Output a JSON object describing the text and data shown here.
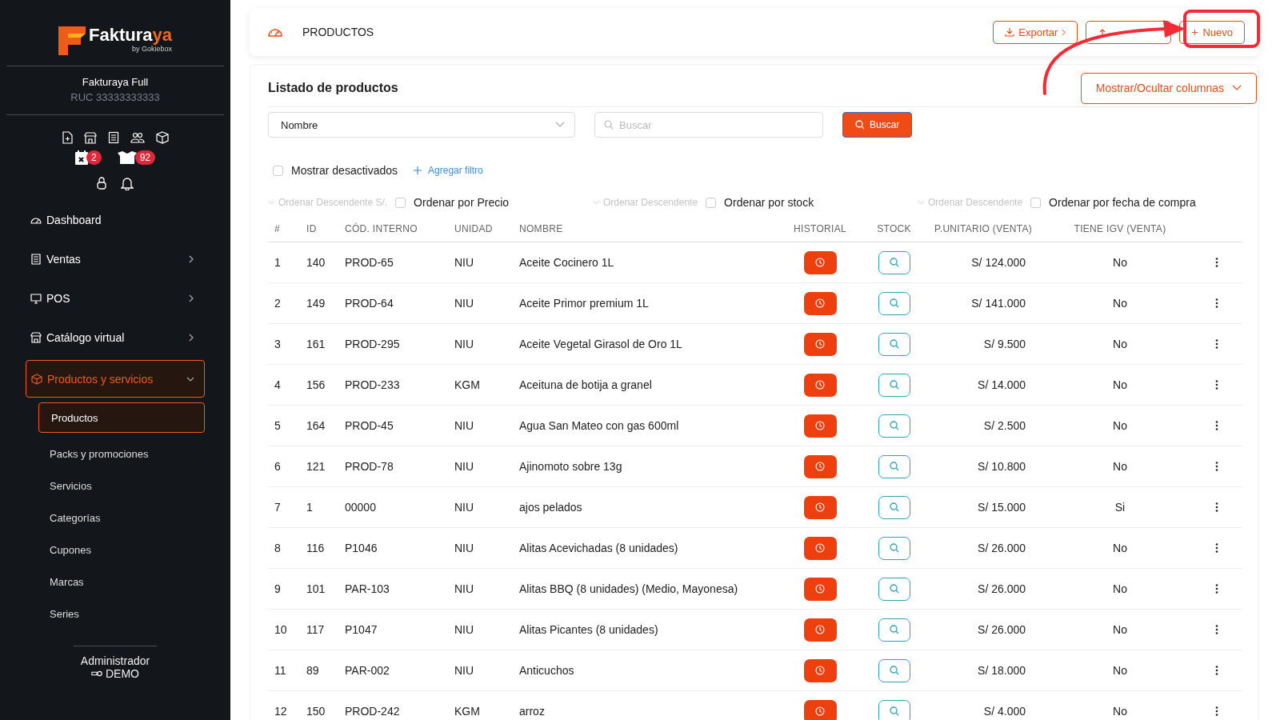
{
  "sidebar": {
    "brand": {
      "name": "Faktura",
      "accent": "ya",
      "tagline": "by Gokiebox"
    },
    "company": {
      "name": "Fakturaya Full",
      "ruc": "RUC 33333333333"
    },
    "badges": [
      {
        "kind": "calendar",
        "count": "2"
      },
      {
        "kind": "boxes",
        "count": "92"
      }
    ],
    "menu": [
      {
        "kind": "dashboard",
        "label": "Dashboard",
        "selected": false
      },
      {
        "kind": "sales",
        "label": "Ventas",
        "selected": false,
        "expanded": false
      },
      {
        "kind": "pos",
        "label": "POS",
        "selected": false,
        "expanded": false
      },
      {
        "kind": "store",
        "label": "Catálogo virtual",
        "selected": false,
        "expanded": false
      },
      {
        "kind": "box",
        "label": "Productos y servicios",
        "selected": true,
        "expanded": true,
        "children": [
          {
            "label": "Productos",
            "selected": true
          },
          {
            "label": "Packs y promociones",
            "selected": false
          },
          {
            "label": "Servicios",
            "selected": false
          },
          {
            "label": "Categorías",
            "selected": false
          },
          {
            "label": "Cupones",
            "selected": false
          },
          {
            "label": "Marcas",
            "selected": false
          },
          {
            "label": "Series",
            "selected": false
          }
        ]
      }
    ],
    "user": {
      "role": "Administrador",
      "name": "DEMO"
    }
  },
  "header": {
    "title": "PRODUCTOS",
    "buttons": [
      {
        "kind": "export",
        "label": "Exportar"
      },
      {
        "kind": "import"
      },
      {
        "kind": "new",
        "label": "Nuevo"
      }
    ]
  },
  "list": {
    "title": "Listado de productos",
    "columns_toggle": "Mostrar/Ocultar columnas",
    "field_select": "Nombre",
    "search": {
      "placeholder": "Buscar"
    },
    "search_button": "Buscar",
    "show_disabled": {
      "label": "Mostrar desactivados",
      "checked": false
    },
    "add_filter": "Agregar filtro",
    "sorts": [
      {
        "direction": "Ordenar Descendente S/.",
        "label": "Ordenar por Precio",
        "checked": false
      },
      {
        "direction": "Ordenar Descendente",
        "label": "Ordenar por stock",
        "checked": false
      },
      {
        "direction": "Ordenar Descendente",
        "label": "Ordenar por fecha de compra",
        "checked": false
      }
    ]
  },
  "table": {
    "columns": [
      "#",
      "ID",
      "CÓD. INTERNO",
      "UNIDAD",
      "NOMBRE",
      "HISTORIAL",
      "STOCK",
      "P.UNITARIO (VENTA)",
      "TIENE IGV (VENTA)"
    ],
    "rows": [
      {
        "n": "1",
        "id": "140",
        "code": "PROD-65",
        "unit": "NIU",
        "name": "Aceite Cocinero 1L",
        "price": "S/ 124.000",
        "igv": "No"
      },
      {
        "n": "2",
        "id": "149",
        "code": "PROD-64",
        "unit": "NIU",
        "name": "Aceite Primor premium 1L",
        "price": "S/ 141.000",
        "igv": "No"
      },
      {
        "n": "3",
        "id": "161",
        "code": "PROD-295",
        "unit": "NIU",
        "name": "Aceite Vegetal Girasol de Oro 1L",
        "price": "S/ 9.500",
        "igv": "No"
      },
      {
        "n": "4",
        "id": "156",
        "code": "PROD-233",
        "unit": "KGM",
        "name": "Aceituna de botija a granel",
        "price": "S/ 14.000",
        "igv": "No"
      },
      {
        "n": "5",
        "id": "164",
        "code": "PROD-45",
        "unit": "NIU",
        "name": "Agua San Mateo con gas 600ml",
        "price": "S/ 2.500",
        "igv": "No"
      },
      {
        "n": "6",
        "id": "121",
        "code": "PROD-78",
        "unit": "NIU",
        "name": "Ajinomoto sobre 13g",
        "price": "S/ 10.800",
        "igv": "No"
      },
      {
        "n": "7",
        "id": "1",
        "code": "00000",
        "unit": "NIU",
        "name": "ajos pelados",
        "price": "S/ 15.000",
        "igv": "Si"
      },
      {
        "n": "8",
        "id": "116",
        "code": "P1046",
        "unit": "NIU",
        "name": "Alitas Acevichadas (8 unidades)",
        "price": "S/ 26.000",
        "igv": "No"
      },
      {
        "n": "9",
        "id": "101",
        "code": "PAR-103",
        "unit": "NIU",
        "name": "Alitas BBQ (8 unidades) (Medio, Mayonesa)",
        "price": "S/ 26.000",
        "igv": "No"
      },
      {
        "n": "10",
        "id": "117",
        "code": "P1047",
        "unit": "NIU",
        "name": "Alitas Picantes (8 unidades)",
        "price": "S/ 26.000",
        "igv": "No"
      },
      {
        "n": "11",
        "id": "89",
        "code": "PAR-002",
        "unit": "NIU",
        "name": "Anticuchos",
        "price": "S/ 18.000",
        "igv": "No"
      },
      {
        "n": "12",
        "id": "150",
        "code": "PROD-242",
        "unit": "KGM",
        "name": "arroz",
        "price": "S/ 4.000",
        "igv": "No"
      }
    ]
  }
}
